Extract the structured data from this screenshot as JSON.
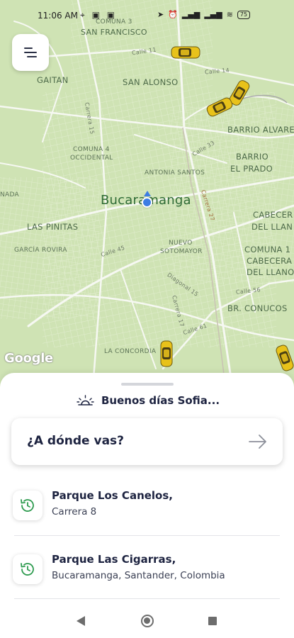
{
  "statusbar": {
    "time": "11:06 AM",
    "battery": "75"
  },
  "map": {
    "labels": {
      "comuna3": "COMUNA 3",
      "san_francisco": "SAN FRANCISCO",
      "calle11": "Calle 11",
      "gaitan": "GAITAN",
      "calle14": "Calle 14",
      "san_alonso": "SAN ALONSO",
      "carrera15": "Carrera 15",
      "barrio_alvarez": "BARRIO ALVAREZ",
      "comuna4_a": "COMUNA 4",
      "comuna4_b": "OCCIDENTAL",
      "calle33": "Calle 33",
      "barrio_el_prado_a": "BARRIO",
      "barrio_el_prado_b": "EL PRADO",
      "antonia_santos": "ANTONIA SANTOS",
      "nada": "NADA",
      "city": "Bucaramanga",
      "carrera27": "Carrera 27",
      "cabecera_a": "CABECER",
      "cabecera_b": "DEL LLAN",
      "las_pinitas": "LAS PINITAS",
      "nuevo_sotomayor_a": "NUEVO",
      "nuevo_sotomayor_b": "SOTOMAYOR",
      "garcia_rovira": "GARCÍA ROVIRA",
      "calle45": "Calle 45",
      "comuna11_a": "COMUNA 1",
      "comuna11_b": "CABECERA",
      "comuna11_c": "DEL LLANO",
      "diagonal15": "Diagonal 15",
      "calle56": "Calle 56",
      "carrera17": "Carrera 17",
      "br_conucos": "BR. CONUCOS",
      "calle61": "Calle 61",
      "la_concordia": "LA CONCORDIA"
    },
    "google_logo": "Google"
  },
  "sheet": {
    "greeting": "Buenos días Sofia...",
    "search_label": "¿A dónde vas?",
    "recents": [
      {
        "title": "Parque Los Canelos,",
        "subtitle": "Carrera 8"
      },
      {
        "title": "Parque Las Cigarras,",
        "subtitle": "Bucaramanga, Santander, Colombia"
      }
    ]
  },
  "icons": {
    "menu": "hamburger-menu-icon",
    "sunrise": "sunrise-icon",
    "arrow": "arrow-right-icon",
    "history": "history-clock-icon",
    "car": "taxi-car-icon"
  },
  "colors": {
    "map_bg": "#cfe3b4",
    "taxi": "#e8c21a",
    "accent_green": "#2e9b4f",
    "text_dark": "#1d2340"
  }
}
